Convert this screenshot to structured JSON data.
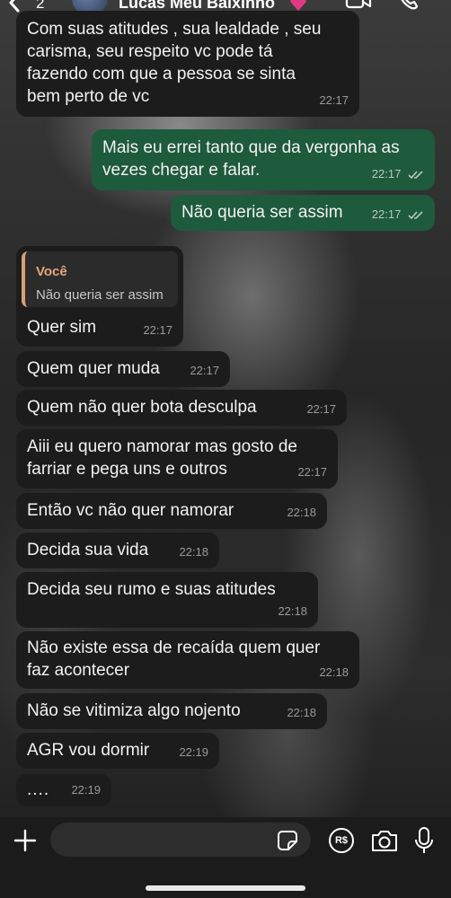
{
  "header": {
    "back_count": "2",
    "contact_name": "Lucas Meu Baixinho",
    "heart_color": "#e03a86"
  },
  "messages": [
    {
      "direction": "in",
      "lines": [
        "Com suas atitudes , sua lealdade , seu",
        "carisma, seu respeito vc pode tá",
        "fazendo com que a pessoa se sinta",
        "bem perto de vc"
      ],
      "time": "22:17"
    },
    {
      "direction": "out",
      "lines": [
        "Mais eu errei tanto que da vergonha as",
        "vezes chegar e falar."
      ],
      "time": "22:17",
      "status": "read"
    },
    {
      "direction": "out",
      "lines": [
        "Não queria ser assim"
      ],
      "time": "22:17",
      "status": "read"
    },
    {
      "direction": "in",
      "quote": {
        "author": "Você",
        "text": "Não queria ser assim"
      },
      "lines": [
        "Quer sim"
      ],
      "time": "22:17"
    },
    {
      "direction": "in",
      "lines": [
        "Quem quer muda"
      ],
      "time": "22:17"
    },
    {
      "direction": "in",
      "lines": [
        "Quem não quer bota desculpa"
      ],
      "time": "22:17"
    },
    {
      "direction": "in",
      "lines": [
        "Aiii eu quero namorar mas gosto de",
        "farriar e pega uns e outros"
      ],
      "time": "22:17"
    },
    {
      "direction": "in",
      "lines": [
        "Então vc não quer namorar"
      ],
      "time": "22:18"
    },
    {
      "direction": "in",
      "lines": [
        "Decida sua vida"
      ],
      "time": "22:18"
    },
    {
      "direction": "in",
      "lines": [
        "Decida seu rumo e suas atitudes"
      ],
      "time": "22:18"
    },
    {
      "direction": "in",
      "lines": [
        "Não existe essa de recaída quem quer",
        "faz acontecer"
      ],
      "time": "22:18"
    },
    {
      "direction": "in",
      "lines": [
        "Não se vitimiza algo nojento"
      ],
      "time": "22:18"
    },
    {
      "direction": "in",
      "lines": [
        "AGR vou dormir"
      ],
      "time": "22:19"
    },
    {
      "direction": "in",
      "lines": [
        "...."
      ],
      "time": "22:19"
    }
  ],
  "composer": {
    "input_value": "",
    "icons": [
      "plus-icon",
      "sticker-icon",
      "money-icon",
      "camera-icon",
      "mic-icon"
    ],
    "money_label": "R$"
  },
  "colors": {
    "incoming_bubble": "#1c1c1c",
    "outgoing_bubble": "#1e5a3c",
    "read_ticks": "#b6ccbe",
    "quote_accent": "#d8a172"
  }
}
